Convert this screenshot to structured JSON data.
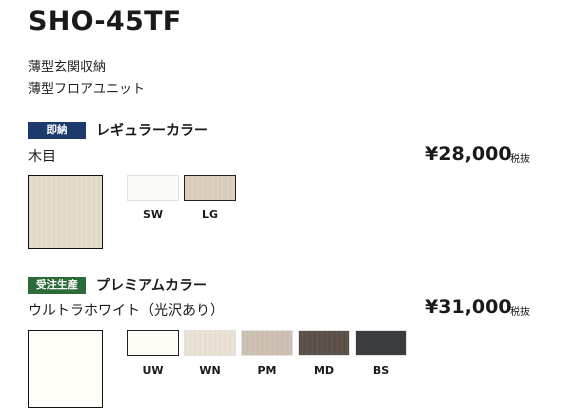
{
  "product": {
    "code": "SHO-45TF",
    "subtitle_lines": [
      "薄型玄関収納",
      "薄型フロアユニット"
    ]
  },
  "regular": {
    "badge": "即納",
    "badge_color": "#1c3b6c",
    "title": "レギュラーカラー",
    "variant": "木目",
    "price": "¥28,000",
    "tax_label": "税抜",
    "main_color": "#e6ddcc",
    "swatches": [
      {
        "code": "SW",
        "color": "#fafaf8",
        "selected": false
      },
      {
        "code": "LG",
        "color": "#ddd1bd",
        "selected": true
      }
    ]
  },
  "premium": {
    "badge": "受注生産",
    "badge_color": "#2b6b3a",
    "title": "プレミアムカラー",
    "variant": "ウルトラホワイト（光沢あり）",
    "price": "¥31,000",
    "tax_label": "税抜",
    "main_color": "#fefdf7",
    "swatches": [
      {
        "code": "UW",
        "color": "#fdfcf6",
        "selected": true
      },
      {
        "code": "WN",
        "color": "#ece3d5",
        "selected": false
      },
      {
        "code": "PM",
        "color": "#cec1b2",
        "selected": false
      },
      {
        "code": "MD",
        "color": "#5a5047",
        "selected": false
      },
      {
        "code": "BS",
        "color": "#3a3c40",
        "selected": false
      }
    ]
  }
}
